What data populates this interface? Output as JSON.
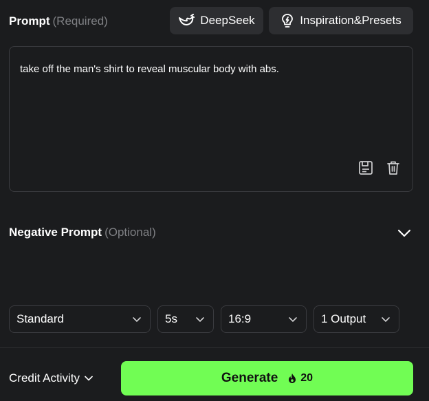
{
  "prompt": {
    "label": "Prompt",
    "hint": "(Required)",
    "text": "take off the man's shirt to reveal muscular body with abs."
  },
  "toolbar": {
    "deepseek_label": "DeepSeek",
    "inspiration_label": "Inspiration&Presets"
  },
  "negative_prompt": {
    "label": "Negative Prompt",
    "hint": "(Optional)"
  },
  "settings": {
    "quality": "Standard",
    "duration": "5s",
    "aspect_ratio": "16:9",
    "outputs": "1 Output"
  },
  "footer": {
    "credit_label": "Credit Activity",
    "generate_label": "Generate",
    "generate_cost": "20"
  },
  "icons": {
    "deepseek": "whale-icon",
    "inspiration": "lightbulb-icon",
    "save": "save-icon",
    "delete": "trash-icon",
    "expand": "chevron-down-icon",
    "cost": "flame-icon"
  },
  "colors": {
    "background": "#1b1c1e",
    "button_bg": "#2d2e31",
    "border": "#3a3b3f",
    "hint_text": "#7f8084",
    "generate_bg": "#71fd54"
  }
}
